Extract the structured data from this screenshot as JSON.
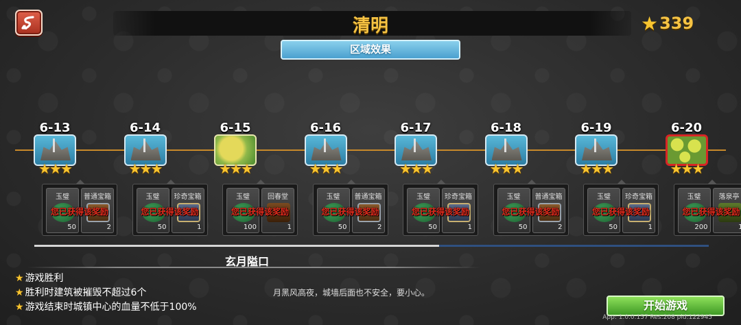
{
  "header": {
    "title": "清明",
    "star_total": "339",
    "area_effect_label": "区域效果"
  },
  "levels": [
    {
      "id": "6-13",
      "stars": "★★★",
      "tile": "fort"
    },
    {
      "id": "6-14",
      "stars": "★★★",
      "tile": "fort"
    },
    {
      "id": "6-15",
      "stars": "★★★",
      "tile": "swamp"
    },
    {
      "id": "6-16",
      "stars": "★★★",
      "tile": "fort"
    },
    {
      "id": "6-17",
      "stars": "★★★",
      "tile": "fort"
    },
    {
      "id": "6-18",
      "stars": "★★★",
      "tile": "fort"
    },
    {
      "id": "6-19",
      "stars": "★★★",
      "tile": "fort"
    },
    {
      "id": "6-20",
      "stars": "★★★",
      "tile": "selected"
    }
  ],
  "rewards": [
    {
      "item1": {
        "label": "玉璧",
        "count": "50",
        "icon": "jade-icon"
      },
      "item2": {
        "label": "普通宝箱",
        "count": "2",
        "icon": "chest-icon"
      },
      "status": "您已获得该奖励"
    },
    {
      "item1": {
        "label": "玉璧",
        "count": "50",
        "icon": "jade-icon"
      },
      "item2": {
        "label": "珍奇宝箱",
        "count": "1",
        "icon": "rare-chest-icon"
      },
      "status": "您已获得该奖励"
    },
    {
      "item1": {
        "label": "玉璧",
        "count": "100",
        "icon": "jade-icon"
      },
      "item2": {
        "label": "回春堂",
        "count": "1",
        "icon": "building-icon"
      },
      "status": "您已获得该奖励"
    },
    {
      "item1": {
        "label": "玉璧",
        "count": "50",
        "icon": "jade-icon"
      },
      "item2": {
        "label": "普通宝箱",
        "count": "2",
        "icon": "chest-icon"
      },
      "status": "您已获得该奖励"
    },
    {
      "item1": {
        "label": "玉璧",
        "count": "50",
        "icon": "jade-icon"
      },
      "item2": {
        "label": "珍奇宝箱",
        "count": "1",
        "icon": "rare-chest-icon"
      },
      "status": "您已获得该奖励"
    },
    {
      "item1": {
        "label": "玉璧",
        "count": "50",
        "icon": "jade-icon"
      },
      "item2": {
        "label": "普通宝箱",
        "count": "2",
        "icon": "chest-icon"
      },
      "status": "您已获得该奖励"
    },
    {
      "item1": {
        "label": "玉璧",
        "count": "50",
        "icon": "jade-icon"
      },
      "item2": {
        "label": "珍奇宝箱",
        "count": "1",
        "icon": "rare-chest-icon"
      },
      "status": "您已获得该奖励"
    },
    {
      "item1": {
        "label": "玉璧",
        "count": "200",
        "icon": "jade-icon"
      },
      "item2": {
        "label": "落泉亭",
        "count": "1",
        "icon": "pavilion-icon"
      },
      "status": "您已获得该奖励"
    }
  ],
  "progress_fraction": 0.6,
  "map_name": "玄月隘口",
  "objectives": [
    "游戏胜利",
    "胜利时建筑被摧毁不超过6个",
    "游戏结束时城镇中心的血量不低于100%"
  ],
  "tip": "月黑风高夜，城墙后面也不安全，要小心。",
  "start_button": "开始游戏",
  "app_info": "App: 1.0.0.157 Res:208 pid:122945",
  "colors": {
    "accent_gold": "#f6c343",
    "obtained_red": "#e02a1c",
    "start_green": "#5cb83a",
    "area_blue": "#6ab8e0"
  }
}
